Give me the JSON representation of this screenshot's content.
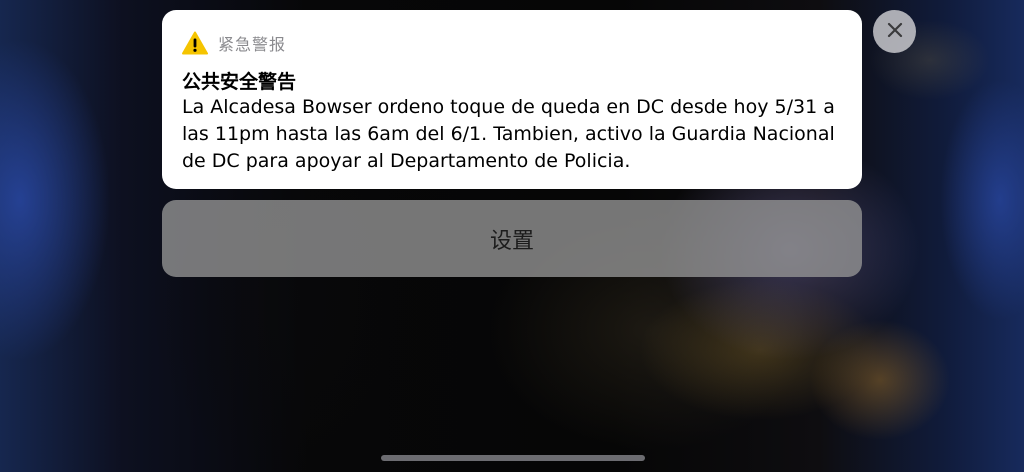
{
  "alert": {
    "app_name": "紧急警报",
    "title": "公共安全警告",
    "body": "La Alcadesa Bowser ordeno toque de queda en DC desde hoy 5/31 a las 11pm hasta las 6am del 6/1. Tambien, activo la Guardia Nacional de DC para apoyar al Departamento de Policia.",
    "icon": "warning-icon"
  },
  "actions": {
    "settings_label": "设置",
    "close_icon": "close-icon"
  },
  "colors": {
    "card_background": "#ffffff",
    "warning_yellow": "#f5c400",
    "app_name_gray": "#8a8a8e"
  }
}
